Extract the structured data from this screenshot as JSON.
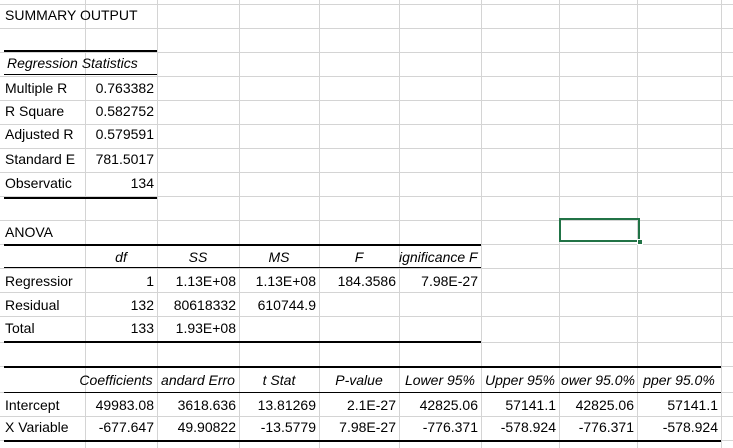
{
  "title": "SUMMARY OUTPUT",
  "regression_statistics": {
    "header": "Regression Statistics",
    "rows": [
      {
        "label": "Multiple R",
        "value": "0.763382"
      },
      {
        "label": "R Square",
        "value": "0.582752"
      },
      {
        "label": "Adjusted R",
        "value": "0.579591"
      },
      {
        "label": "Standard E",
        "value": "781.5017"
      },
      {
        "label": "Observatic",
        "value": "134"
      }
    ]
  },
  "anova": {
    "title": "ANOVA",
    "headers": [
      "df",
      "SS",
      "MS",
      "F",
      "ignificance F"
    ],
    "rows": [
      {
        "label": "Regressior",
        "df": "1",
        "ss": "1.13E+08",
        "ms": "1.13E+08",
        "f": "184.3586",
        "sig": "7.98E-27"
      },
      {
        "label": "Residual",
        "df": "132",
        "ss": "80618332",
        "ms": "610744.9",
        "f": "",
        "sig": ""
      },
      {
        "label": "Total",
        "df": "133",
        "ss": "1.93E+08",
        "ms": "",
        "f": "",
        "sig": ""
      }
    ]
  },
  "coefficients": {
    "headers": [
      "Coefficients",
      "andard Erro",
      "t Stat",
      "P-value",
      "Lower 95%",
      "Upper 95%",
      "ower 95.0%",
      "pper 95.0%"
    ],
    "rows": [
      {
        "label": "Intercept",
        "values": [
          "49983.08",
          "3618.636",
          "13.81269",
          "2.1E-27",
          "42825.06",
          "57141.1",
          "42825.06",
          "57141.1"
        ]
      },
      {
        "label": "X Variable",
        "values": [
          "-677.647",
          "49.90822",
          "-13.5779",
          "7.98E-27",
          "-776.371",
          "-578.924",
          "-776.371",
          "-578.924"
        ]
      }
    ]
  },
  "colors": {
    "gridline": "#d4d4d4",
    "selection": "#217346"
  }
}
